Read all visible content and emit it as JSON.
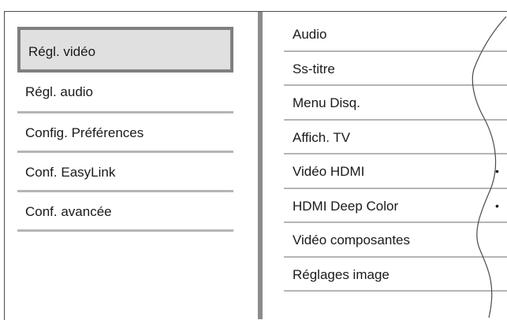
{
  "left_menu": {
    "items": [
      {
        "label": "Régl. vidéo",
        "selected": true
      },
      {
        "label": "Régl. audio",
        "selected": false
      },
      {
        "label": "Config. Préférences",
        "selected": false
      },
      {
        "label": "Conf. EasyLink",
        "selected": false
      },
      {
        "label": "Conf. avancée",
        "selected": false
      }
    ]
  },
  "right_menu": {
    "items": [
      {
        "label": "Audio"
      },
      {
        "label": "Ss-titre"
      },
      {
        "label": "Menu Disq."
      },
      {
        "label": "Affich. TV"
      },
      {
        "label": "Vidéo HDMI",
        "bullet": "•"
      },
      {
        "label": "HDMI Deep Color",
        "bullet": "•"
      },
      {
        "label": "Vidéo composantes"
      },
      {
        "label": "Réglages image"
      }
    ]
  },
  "colors": {
    "selected_bg": "#e0e0e0",
    "selected_border": "#7f7f7f",
    "separator": "#b5b5b5",
    "divider": "#8c8c8c"
  }
}
